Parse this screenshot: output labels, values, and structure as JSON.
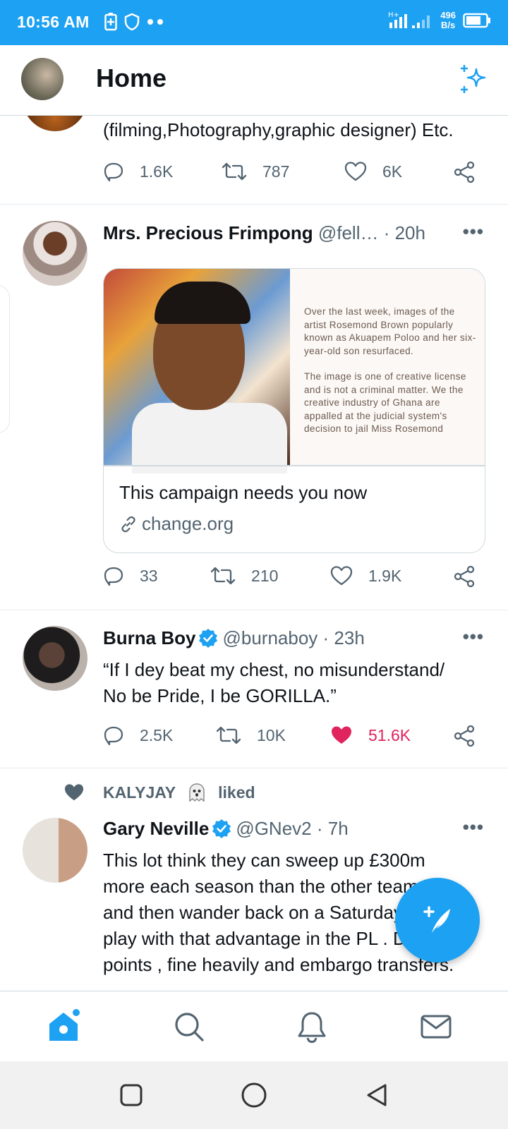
{
  "status": {
    "time": "10:56 AM",
    "net_speed_value": "496",
    "net_speed_unit": "B/s"
  },
  "header": {
    "title": "Home"
  },
  "tweets": [
    {
      "text": "(filming,Photography,graphic designer) Etc.",
      "replies": "1.6K",
      "retweets": "787",
      "likes": "6K"
    },
    {
      "name": "Mrs. Precious Frimpong",
      "handle": "@fell…",
      "time": "· 20h",
      "card": {
        "doc_p1": "Over the last week, images of the artist Rosemond Brown popularly known as Akuapem Poloo and her six-year-old son resurfaced.",
        "doc_p2": "The image is one of creative license and is not a criminal matter. We the creative industry of Ghana are appalled at the judicial system's decision to jail Miss Rosemond",
        "title": "This campaign needs you now",
        "domain": "change.org"
      },
      "replies": "33",
      "retweets": "210",
      "likes": "1.9K"
    },
    {
      "name": "Burna Boy",
      "handle": "@burnaboy",
      "time": "· 23h",
      "text_line1": "“If I dey beat my chest, no misunderstand/",
      "text_line2": "No be Pride, I be GORILLA.”",
      "replies": "2.5K",
      "retweets": "10K",
      "likes": "51.6K"
    },
    {
      "liked_by": "KALYJAY",
      "liked_label": "liked",
      "name": "Gary Neville",
      "handle": "@GNev2",
      "time": "· 7h",
      "text_line1": "This lot think they can sweep up £300m",
      "text_line2": "more each season than the other teams",
      "text_line3": "and then wander back on a Saturday and",
      "text_line4": "play with that advantage in the PL . Deduct",
      "text_line5": "points , fine heavily and embargo transfers."
    }
  ],
  "colors": {
    "accent": "#1da1f2",
    "like": "#e0245e",
    "muted": "#536471"
  }
}
